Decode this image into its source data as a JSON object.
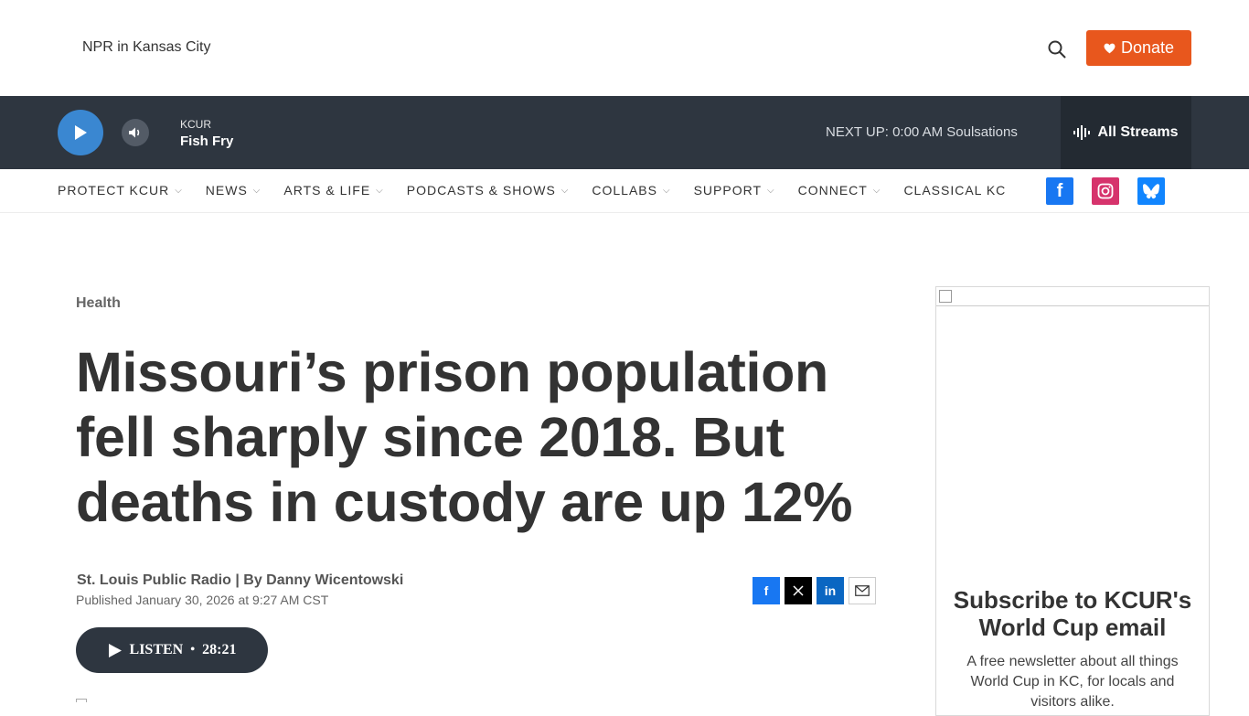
{
  "header": {
    "brand": "NPR in Kansas City",
    "donate_label": "Donate",
    "donate_color": "#e8571d"
  },
  "player": {
    "station_call": "KCUR",
    "show_name": "Fish Fry",
    "next_up": "NEXT UP: 0:00 AM Soulsations",
    "streams_label": "All Streams"
  },
  "nav": {
    "items": [
      {
        "label": "PROTECT KCUR",
        "has_menu": true
      },
      {
        "label": "NEWS",
        "has_menu": true
      },
      {
        "label": "ARTS & LIFE",
        "has_menu": true
      },
      {
        "label": "PODCASTS & SHOWS",
        "has_menu": true
      },
      {
        "label": "COLLABS",
        "has_menu": true
      },
      {
        "label": "SUPPORT",
        "has_menu": true
      },
      {
        "label": "CONNECT",
        "has_menu": true
      },
      {
        "label": "CLASSICAL KC",
        "has_menu": false
      }
    ],
    "social": [
      "facebook-icon",
      "instagram-icon",
      "bluesky-icon"
    ]
  },
  "article": {
    "category": "Health",
    "headline": "Missouri’s prison population fell sharply since 2018. But deaths in custody are up 12%",
    "byline": "St. Louis Public Radio | By Danny Wicentowski",
    "published": "Published January 30, 2026 at 9:27 AM CST",
    "listen_label": "LISTEN",
    "listen_separator": "•",
    "listen_duration": "28:21"
  },
  "sidebar": {
    "promo_title": "Subscribe to KCUR's World Cup email",
    "promo_text": "A free newsletter about all things World Cup in KC, for locals and visitors alike."
  }
}
